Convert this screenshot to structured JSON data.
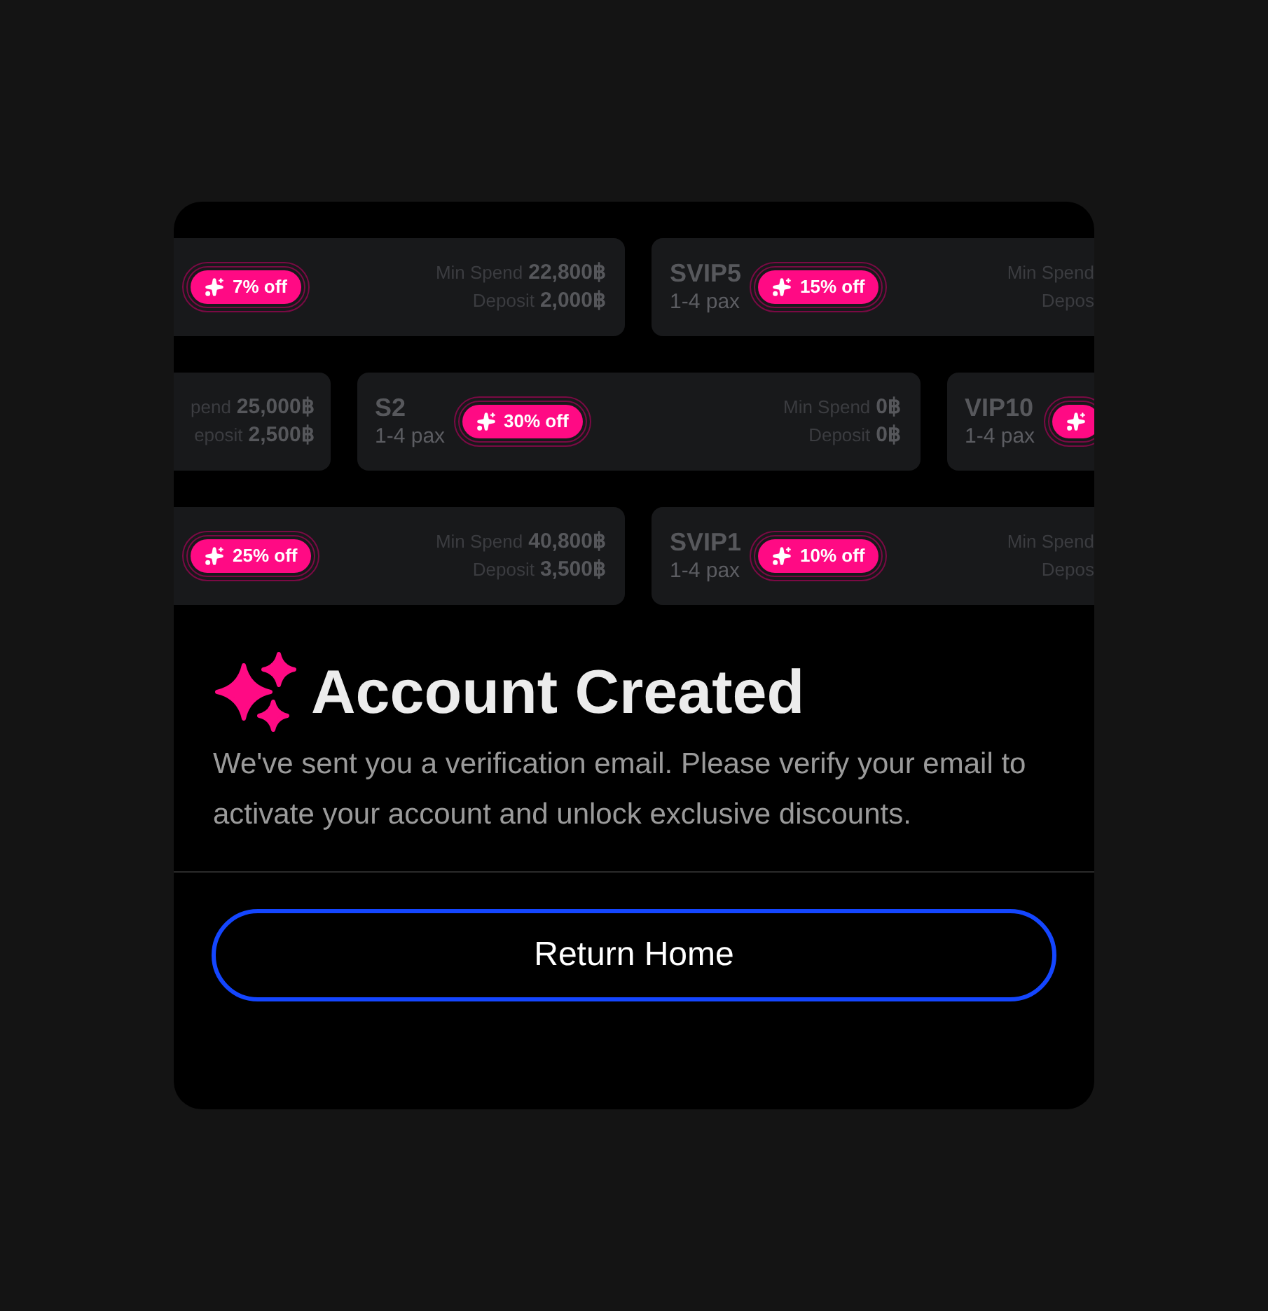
{
  "promo_rows": [
    {
      "cards": [
        {
          "badge": true,
          "discount": "7% off",
          "min_spend_label": "Min Spend",
          "min_spend": "22,800฿",
          "deposit_label": "Deposit",
          "deposit": "2,000฿"
        },
        {
          "name": "SVIP5",
          "pax": "1-4 pax",
          "badge": true,
          "discount": "15% off",
          "min_spend_label": "Min Spend",
          "deposit_label": "Depos"
        }
      ]
    },
    {
      "cards": [
        {
          "min_spend_label": "pend",
          "min_spend": "25,000฿",
          "deposit_label": "eposit",
          "deposit": "2,500฿"
        },
        {
          "name": "S2",
          "pax": "1-4 pax",
          "badge": true,
          "discount": "30% off",
          "min_spend_label": "Min Spend",
          "min_spend": "0฿",
          "deposit_label": "Deposit",
          "deposit": "0฿"
        },
        {
          "name": "VIP10",
          "pax": "1-4 pax",
          "badge": true
        }
      ]
    },
    {
      "cards": [
        {
          "badge": true,
          "discount": "25% off",
          "min_spend_label": "Min Spend",
          "min_spend": "40,800฿",
          "deposit_label": "Deposit",
          "deposit": "3,500฿"
        },
        {
          "name": "SVIP1",
          "pax": "1-4 pax",
          "badge": true,
          "discount": "10% off",
          "min_spend_label": "Min Spend",
          "deposit_label": "Depos"
        }
      ]
    }
  ],
  "title": "Account Created",
  "message": "We've sent you a verification email. Please verify your email to activate your account and unlock exclusive discounts.",
  "button": "Return Home"
}
